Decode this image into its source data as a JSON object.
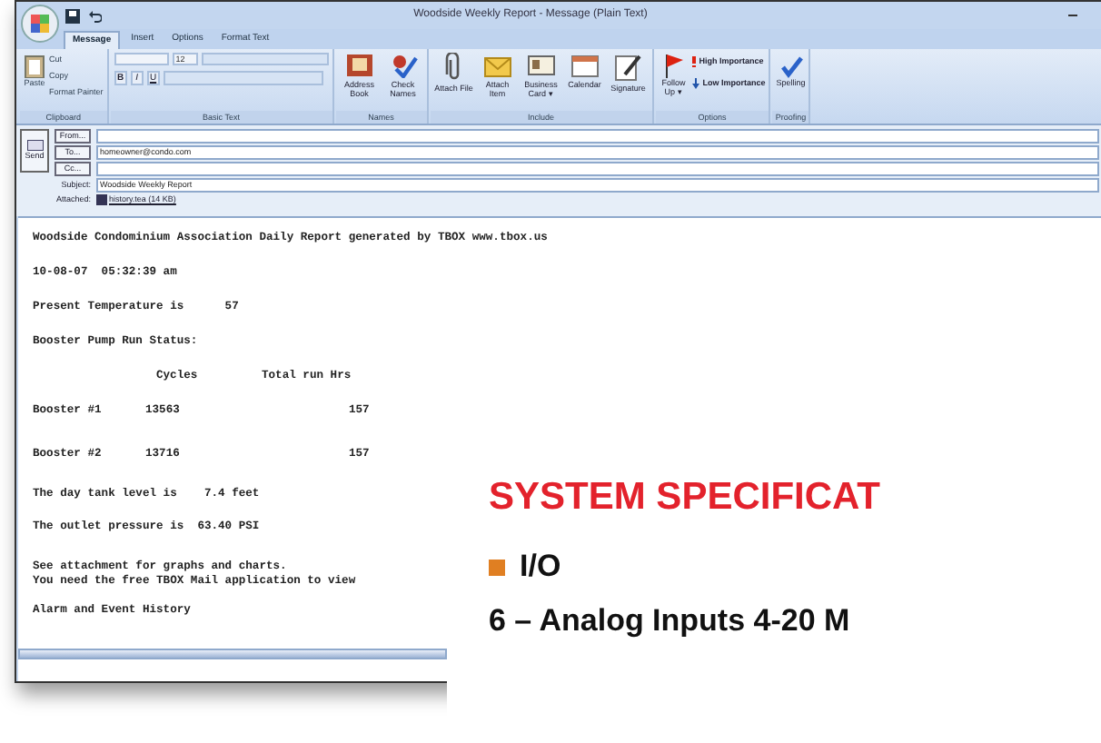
{
  "window": {
    "title": "Woodside Weekly Report - Message (Plain Text)"
  },
  "tabs": [
    {
      "label": "Message",
      "selected": true
    },
    {
      "label": "Insert",
      "selected": false
    },
    {
      "label": "Options",
      "selected": false
    },
    {
      "label": "Format Text",
      "selected": false
    }
  ],
  "ribbon": {
    "clipboard": {
      "paste": "Paste",
      "small": [
        "Cut",
        "Copy",
        "Format Painter"
      ],
      "label": "Clipboard"
    },
    "basic_text": {
      "font_size": "12",
      "format_buttons": [
        "B",
        "I",
        "U"
      ],
      "label": "Basic Text"
    },
    "groups": [
      {
        "label": "Names",
        "buttons": [
          {
            "label": "Address Book"
          },
          {
            "label": "Check Names"
          }
        ]
      },
      {
        "label": "Include",
        "buttons": [
          {
            "label": "Attach File"
          },
          {
            "label": "Attach Item"
          },
          {
            "label": "Business Card ▾"
          },
          {
            "label": "Calendar"
          },
          {
            "label": "Signature"
          }
        ]
      }
    ],
    "options": {
      "follow_up": "Follow Up ▾",
      "high": "High Importance",
      "low": "Low Importance",
      "label": "Options"
    },
    "proofing": {
      "spelling": "Spelling",
      "label": "Proofing"
    }
  },
  "header": {
    "send": "Send",
    "fields": [
      {
        "button": "From..."
      },
      {
        "button": "To...",
        "value": "homeowner@condo.com"
      },
      {
        "button": "Cc..."
      }
    ],
    "subject_label": "Subject:",
    "subject": "Woodside Weekly Report",
    "attached_label": "Attached:",
    "attachment": "history.tea (14 KB)"
  },
  "body": {
    "lines": [
      "Woodside Condominium Association Daily Report generated by TBOX www.tbox.us",
      "10-08-07  05:32:39 am",
      "Present Temperature is      57",
      "Booster Pump Run Status:"
    ],
    "table": {
      "columns": [
        "",
        "Cycles",
        "Total run Hrs"
      ],
      "rows": [
        [
          "Booster #1",
          "13563",
          "157"
        ],
        [
          "Booster #2",
          "13716",
          "157"
        ]
      ]
    },
    "lines_2": [
      "The day tank level is    7.4 feet",
      "The outlet pressure is  63.40 PSI"
    ],
    "lines_3": [
      "See attachment for graphs and charts.\nYou need the free TBOX Mail application to view",
      "Alarm and Event History"
    ]
  },
  "page": {
    "heading": "SYSTEM SPECIFICAT",
    "section": "I/O",
    "item": "6 – Analog Inputs 4-20 M"
  }
}
